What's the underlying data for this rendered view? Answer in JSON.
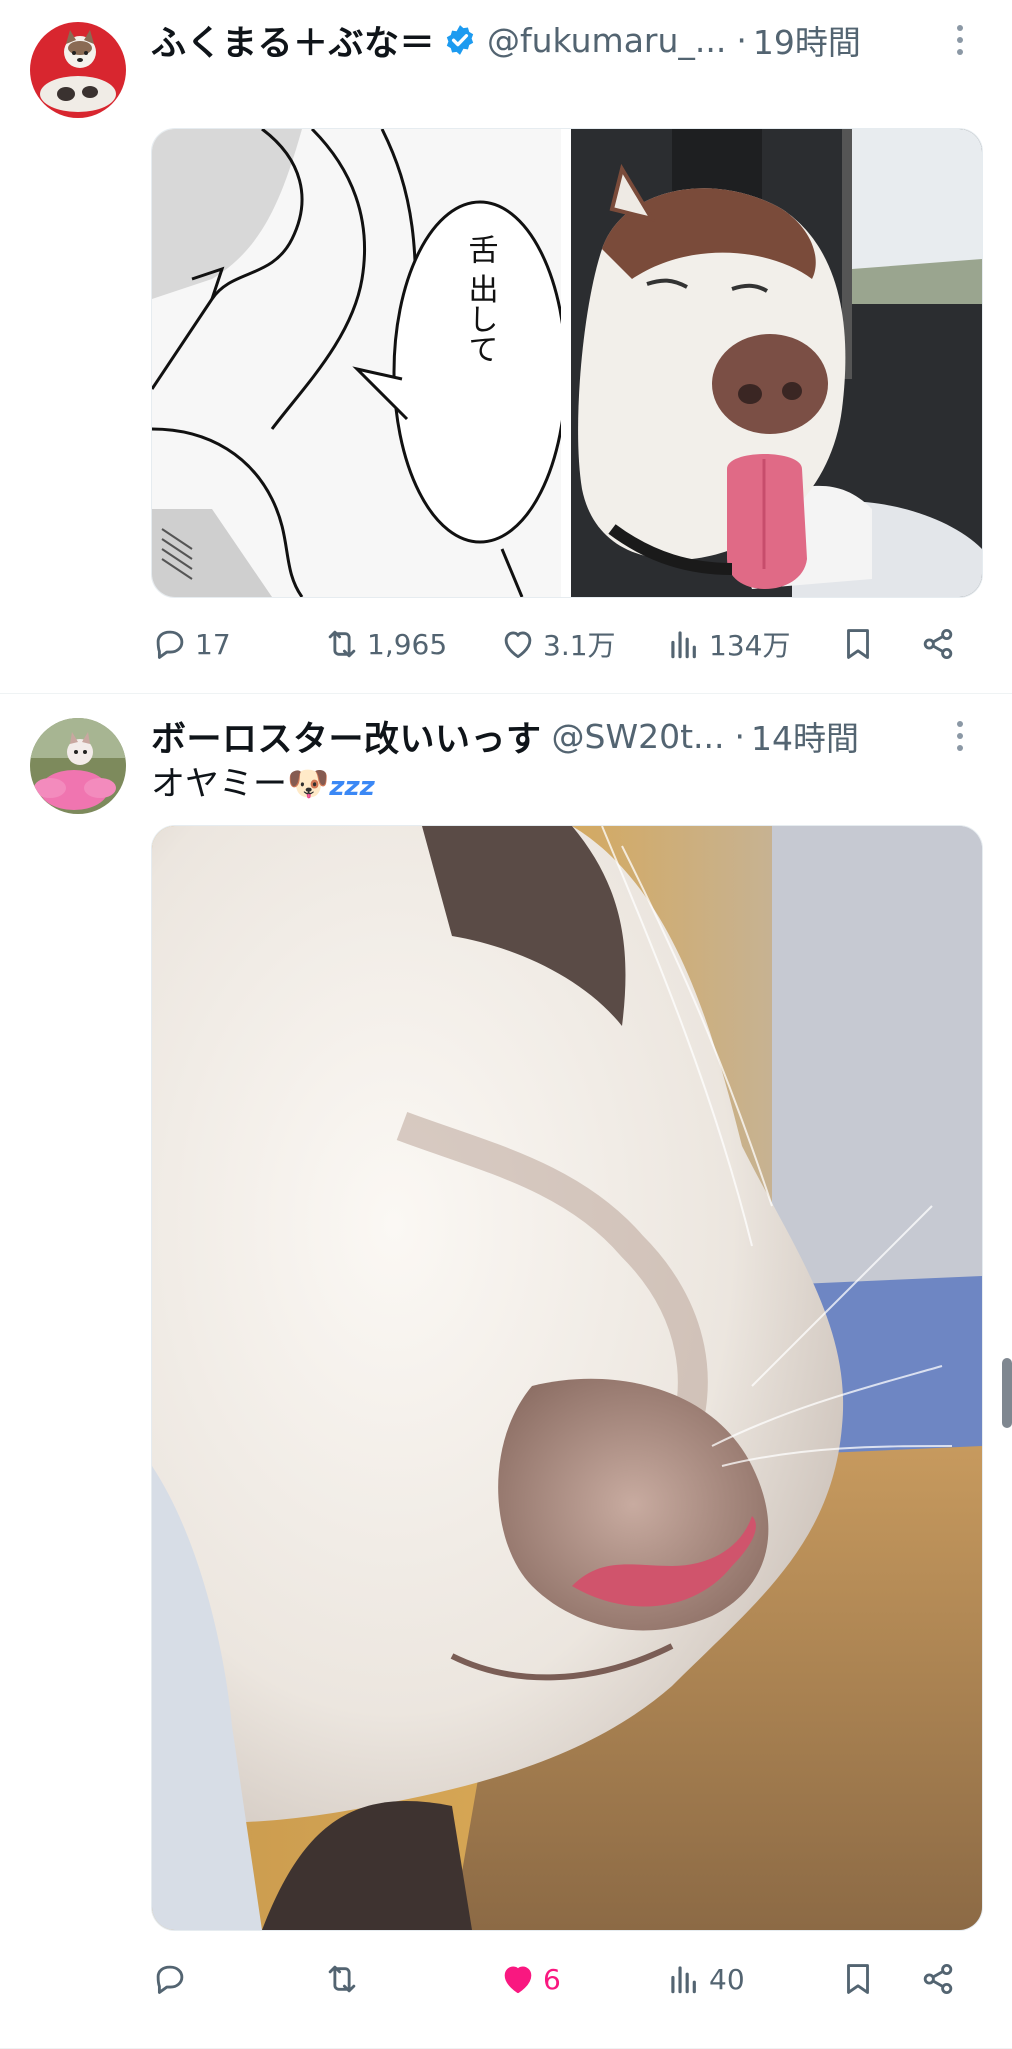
{
  "tweets": [
    {
      "display_name": "ふくまる＋ぶな＝",
      "handle": "@fukumaru_...",
      "separator": "·",
      "time": "19時間",
      "media_text": "舌 出して",
      "stats": {
        "replies": "17",
        "retweets": "1,965",
        "likes": "3.1万",
        "views": "134万"
      }
    },
    {
      "display_name": "ボーロスター改いいっす",
      "handle": "@SW20t...",
      "separator": "·",
      "time": "14時間",
      "text": "オヤミー",
      "text_emoji": "🐶",
      "text_zzz": "zzz",
      "stats": {
        "replies": "",
        "retweets": "",
        "likes": "6",
        "views": "40"
      }
    }
  ],
  "colors": {
    "verified": "#1d9bf0",
    "like_active": "#f91880",
    "meta_gray": "#536471"
  },
  "icons": [
    "reply-icon",
    "retweet-icon",
    "like-icon",
    "views-icon",
    "bookmark-icon",
    "share-icon",
    "more-icon",
    "verified-badge-icon"
  ]
}
